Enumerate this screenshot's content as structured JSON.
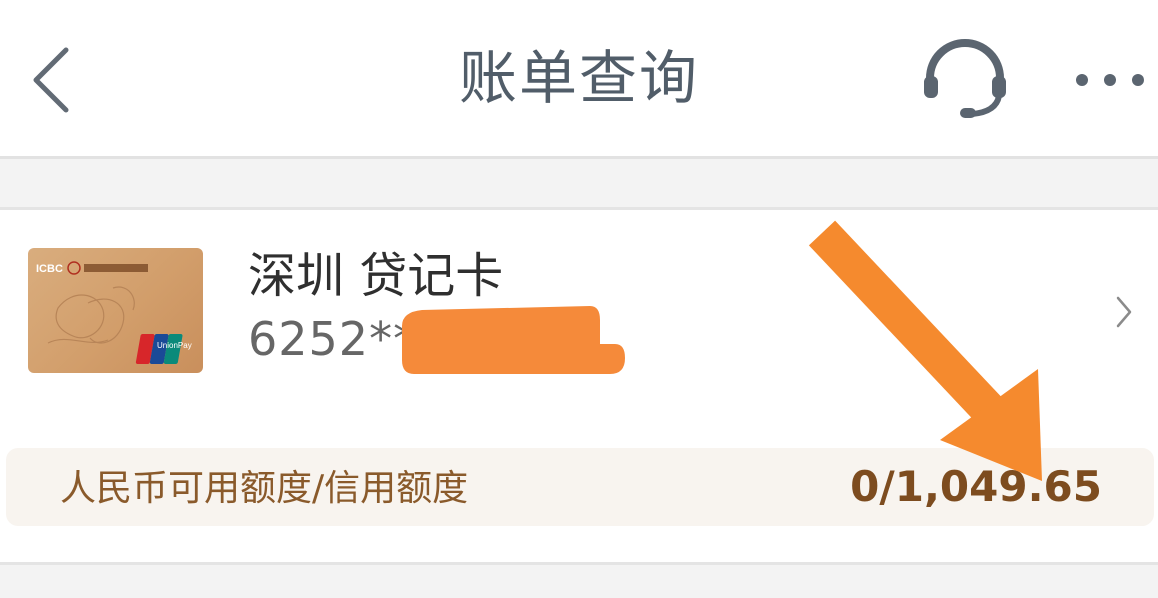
{
  "header": {
    "title": "账单查询",
    "back_icon": "back-icon",
    "support_icon": "headset-icon",
    "more_icon": "more-icon"
  },
  "card": {
    "name": "深圳 贷记卡",
    "number_prefix": "6252**",
    "image_brand": "ICBC 中国工商银行",
    "network": "UnionPay 银联"
  },
  "credit": {
    "label": "人民币可用额度/信用额度",
    "value": "0/1,049.65"
  },
  "colors": {
    "title": "#515d69",
    "credit_label": "#8a5a2b",
    "credit_value": "#7d4c1f",
    "annotation_arrow": "#f58a2e",
    "redaction": "#f58a3a"
  }
}
